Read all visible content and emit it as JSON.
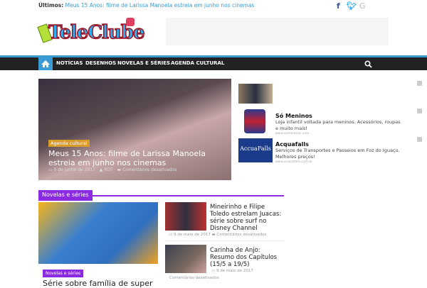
{
  "topbar": {
    "latest_label": "Últimos:",
    "latest_link": "Meus 15 Anos: filme de Larissa Manoela estreia em junho nos cinemas",
    "social": [
      {
        "icon": "facebook-icon",
        "glyph": "f",
        "color": "#3b5998"
      },
      {
        "icon": "twitter-icon",
        "glyph": "t",
        "color": "#1da1f2"
      },
      {
        "icon": "google-icon",
        "glyph": "G",
        "color": "#bbbbbb"
      }
    ]
  },
  "logo": {
    "text": "TeleClube"
  },
  "nav": {
    "items": [
      "NOTÍCIAS",
      "DESENHOS",
      "NOVELAS E SÉRIES",
      "AGENDA CULTURAL"
    ],
    "accent": "#3b9bd3"
  },
  "slider": {
    "tag": "Agenda cultural",
    "title": "Meus 15 Anos: filme de Larissa Manoela estreia em junho nos cinemas",
    "date": "5 de junho de 2017",
    "author": "RDT",
    "comments": "Comentários desativados"
  },
  "sidebar": {
    "ads": [
      {
        "title": "Só Meninos",
        "desc": "Loja infantil voltada para meninos. Acessórios, roupas e muito mais!",
        "url": "www.someninos.com"
      },
      {
        "title": "Acquafalls",
        "desc": "Serviços de Transportes e Passeios em Foz do Iguaçu. Melhores preços!",
        "url": "www.acquafalls.com.br",
        "logo": "AccuaFalls"
      }
    ]
  },
  "section": {
    "title": "Novelas e séries",
    "accent": "#8a2be2",
    "featured": {
      "tag": "Novelas e séries",
      "title": "Série sobre família de super"
    },
    "articles": [
      {
        "title": "Mineirinho e Filipe Toledo estrelam Juacas: série sobre surf no Disney Channel",
        "date": "9 de maio de 2017",
        "comments": "Comentários desativados"
      },
      {
        "title": "Carinha de Anjo: Resumo dos Capítulos (15/5 a 19/5)",
        "date": "9 de maio de 2017",
        "comments": "Comentários desativados"
      }
    ]
  }
}
